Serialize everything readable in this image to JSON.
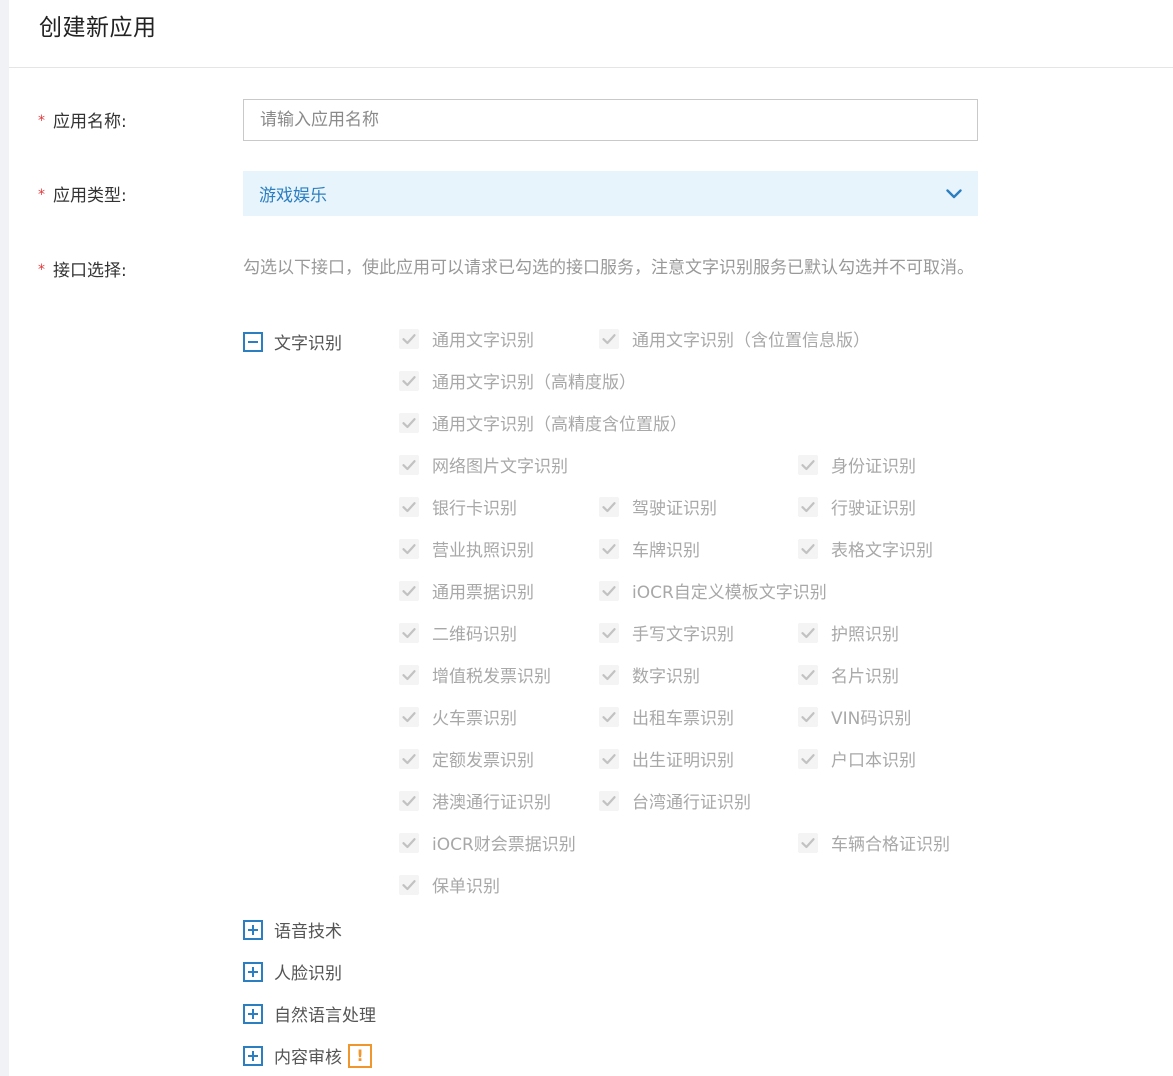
{
  "page": {
    "title": "创建新应用"
  },
  "form": {
    "required_mark": "*",
    "name": {
      "label": "应用名称:",
      "placeholder": "请输入应用名称",
      "value": ""
    },
    "type": {
      "label": "应用类型:",
      "value": "游戏娱乐",
      "icon": "chevron-down-icon"
    },
    "apis": {
      "label": "接口选择:",
      "intro": "勾选以下接口，使此应用可以请求已勾选的接口服务，注意文字识别服务已默认勾选并不可取消。"
    }
  },
  "groups": [
    {
      "label": "文字识别",
      "expanded": true,
      "icon": "collapse-minus-icon",
      "items": [
        "通用文字识别",
        "通用文字识别（含位置信息版）",
        "通用文字识别（高精度版）",
        "通用文字识别（高精度含位置版）",
        "网络图片文字识别",
        "身份证识别",
        "银行卡识别",
        "驾驶证识别",
        "行驶证识别",
        "营业执照识别",
        "车牌识别",
        "表格文字识别",
        "通用票据识别",
        "iOCR自定义模板文字识别",
        "二维码识别",
        "手写文字识别",
        "护照识别",
        "增值税发票识别",
        "数字识别",
        "名片识别",
        "火车票识别",
        "出租车票识别",
        "VIN码识别",
        "定额发票识别",
        "出生证明识别",
        "户口本识别",
        "港澳通行证识别",
        "台湾通行证识别",
        "iOCR财会票据识别",
        "车辆合格证识别",
        "保单识别"
      ],
      "items_checked": true,
      "items_disabled": true
    },
    {
      "label": "语音技术",
      "expanded": false,
      "icon": "expand-plus-icon"
    },
    {
      "label": "人脸识别",
      "expanded": false,
      "icon": "expand-plus-icon"
    },
    {
      "label": "自然语言处理",
      "expanded": false,
      "icon": "expand-plus-icon"
    },
    {
      "label": "内容审核",
      "expanded": false,
      "icon": "expand-plus-icon",
      "badge": "!",
      "badge_icon": "warning-icon"
    }
  ],
  "colors": {
    "accent": "#2b7fc0",
    "required": "#e4393c",
    "warning": "#f0962e",
    "disabled_text": "#a8a8a8",
    "select_bg": "#e8f4fc"
  }
}
